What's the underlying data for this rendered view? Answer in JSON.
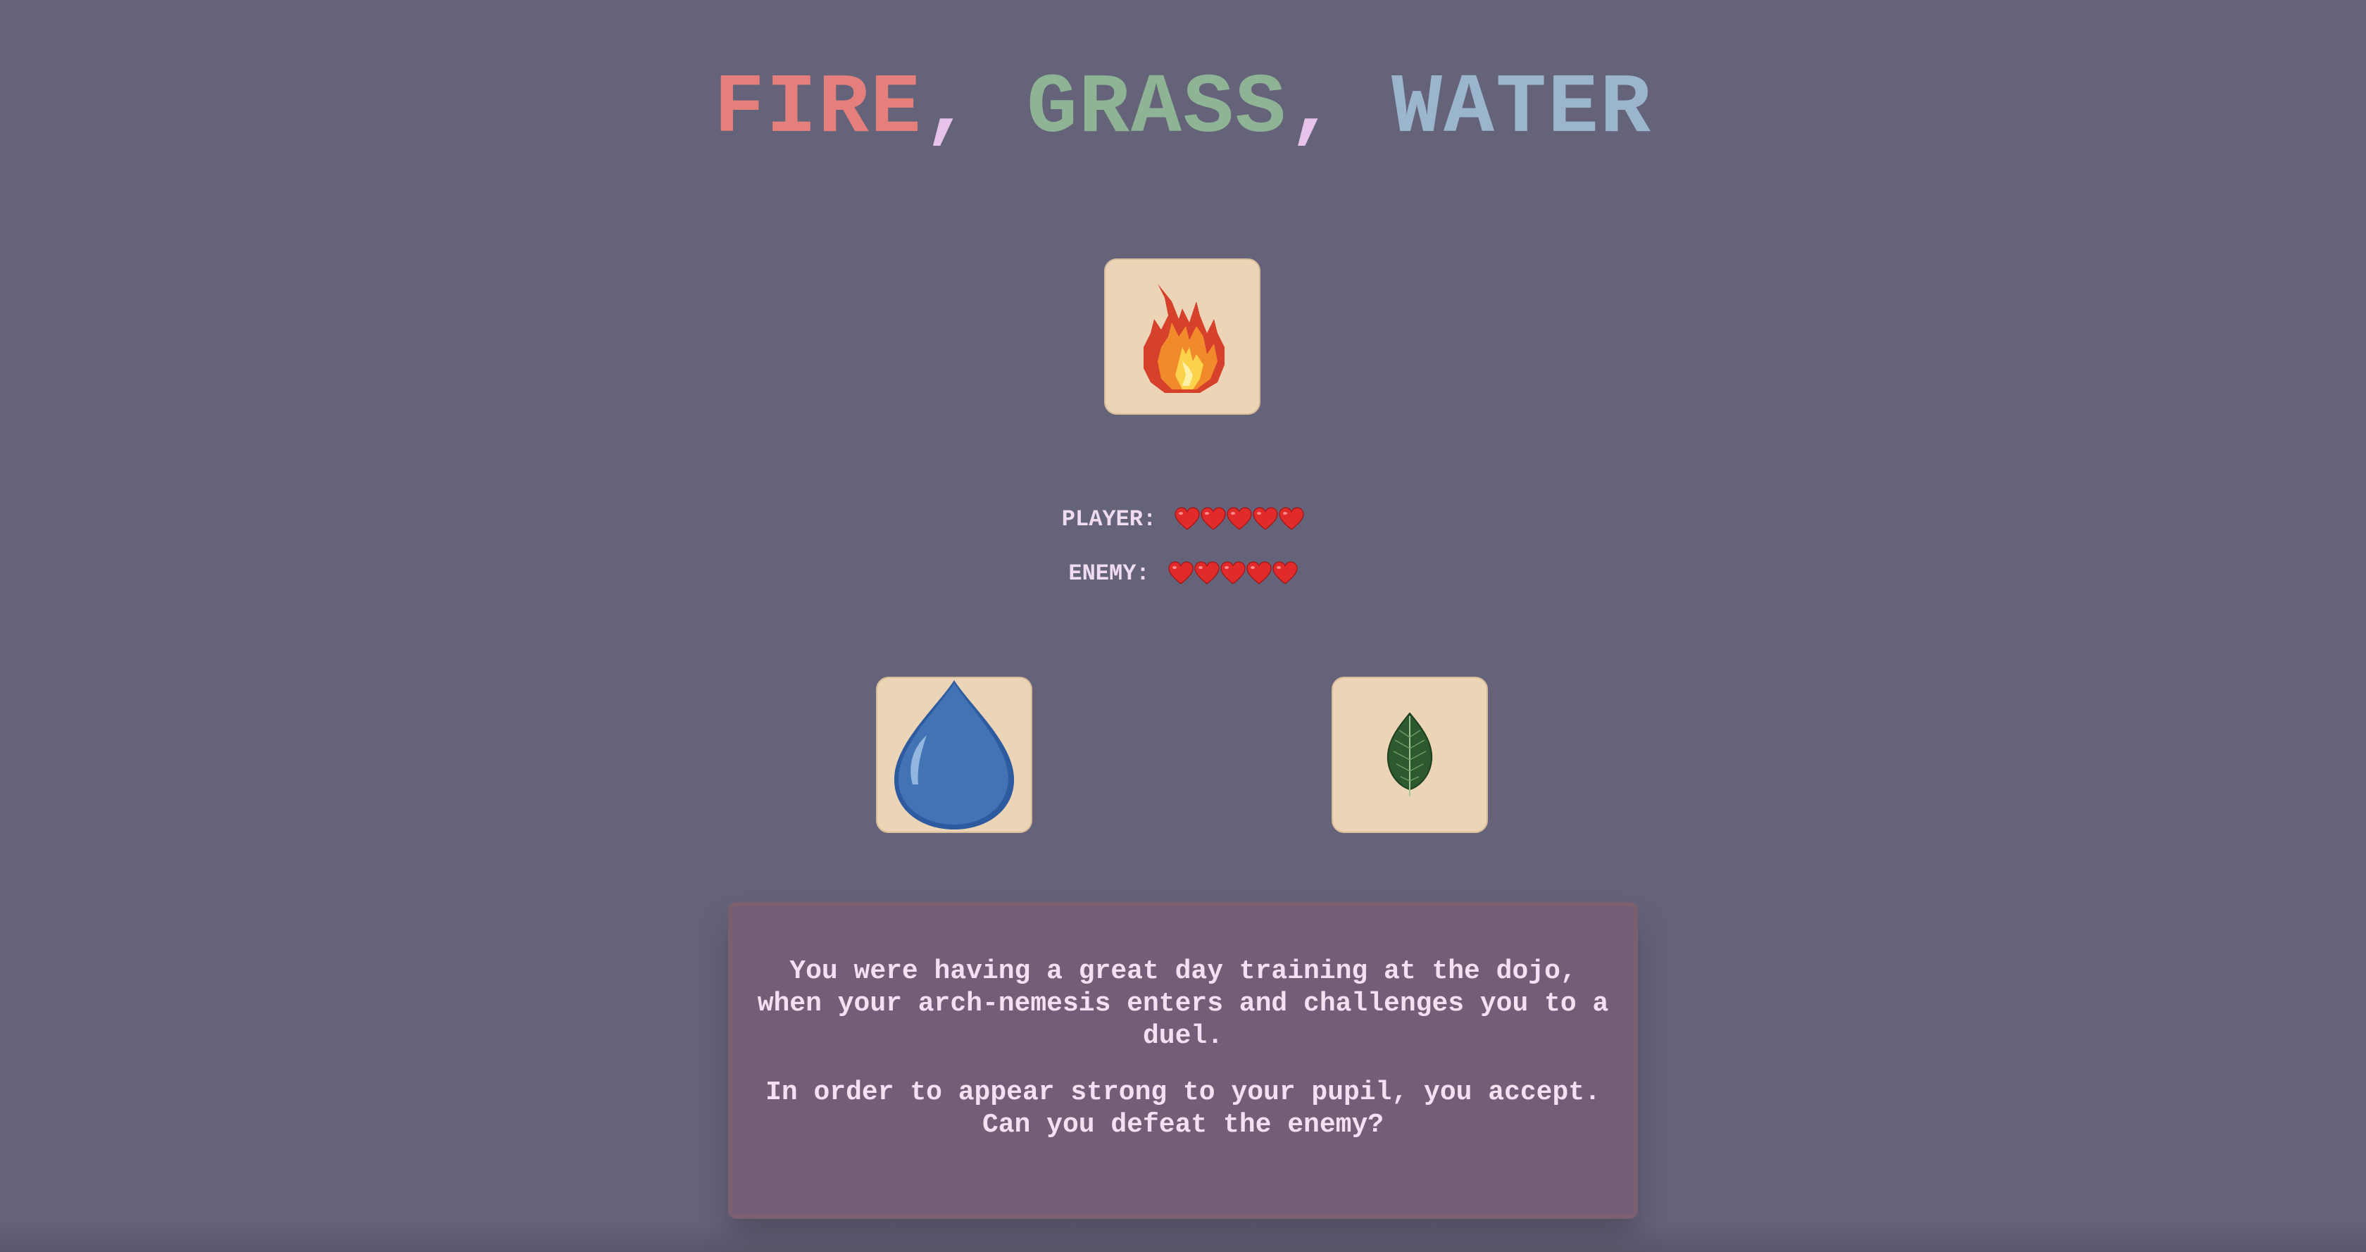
{
  "title": {
    "fire": "FIRE",
    "sep1": ", ",
    "grass": "GRASS",
    "sep2": ", ",
    "water": "WATER",
    "colors": {
      "fire": "#e57f7c",
      "grass": "#8fb495",
      "water": "#9ab5cc",
      "separator": "#e7c3ea"
    }
  },
  "enemy_card": {
    "icon": "fire-icon"
  },
  "health": {
    "player_label": "PLAYER:",
    "enemy_label": "ENEMY:",
    "player_hearts": 5,
    "enemy_hearts": 5,
    "heart_color": "#e12a2a"
  },
  "choices": [
    {
      "id": "water",
      "icon": "water-drop-icon"
    },
    {
      "id": "grass",
      "icon": "leaf-icon"
    }
  ],
  "story": {
    "paragraph1": "You were having a great day training at the dojo, when your arch-nemesis enters and challenges you to a duel.",
    "paragraph2": "In order to appear strong to your pupil, you accept. Can you defeat the enemy?"
  }
}
